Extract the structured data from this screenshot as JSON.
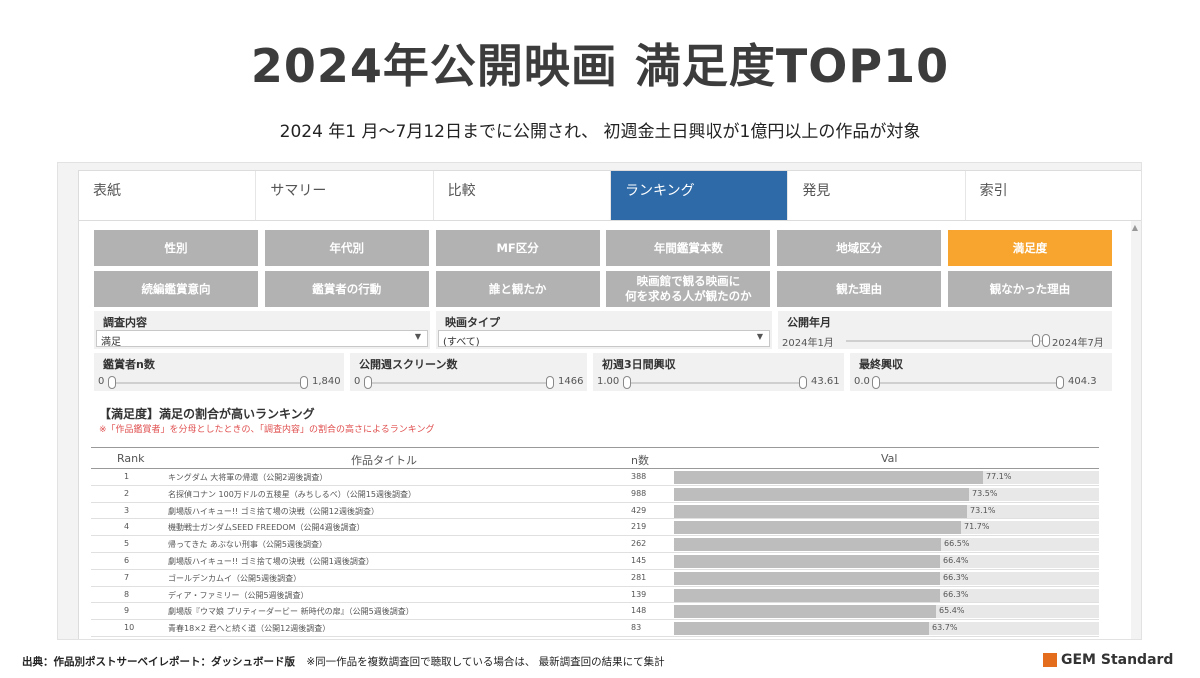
{
  "slide": {
    "title": "2024年公開映画 満足度TOP10",
    "subtitle": "2024 年1 月～7月12日までに公開され、 初週金土日興収が1億円以上の作品が対象"
  },
  "tabs": [
    {
      "label": "表紙",
      "active": false
    },
    {
      "label": "サマリー",
      "active": false
    },
    {
      "label": "比較",
      "active": false
    },
    {
      "label": "ランキング",
      "active": true
    },
    {
      "label": "発見",
      "active": false
    },
    {
      "label": "索引",
      "active": false
    }
  ],
  "category_buttons": [
    {
      "label": "性別",
      "active": false
    },
    {
      "label": "年代別",
      "active": false
    },
    {
      "label": "MF区分",
      "active": false
    },
    {
      "label": "年間鑑賞本数",
      "active": false
    },
    {
      "label": "地域区分",
      "active": false
    },
    {
      "label": "満足度",
      "active": true
    },
    {
      "label": "続編鑑賞意向",
      "active": false
    },
    {
      "label": "鑑賞者の行動",
      "active": false
    },
    {
      "label": "誰と観たか",
      "active": false
    },
    {
      "label": "映画館で観る映画に\n何を求める人が観たのか",
      "active": false
    },
    {
      "label": "観た理由",
      "active": false
    },
    {
      "label": "観なかった理由",
      "active": false
    }
  ],
  "filters": {
    "survey_content": {
      "label": "調査内容",
      "value": "満足"
    },
    "movie_type": {
      "label": "映画タイプ",
      "value": "(すべて)"
    },
    "release_period": {
      "label": "公開年月",
      "min": "2024年1月",
      "max": "2024年7月",
      "level_start": 0.95,
      "level_end": 1.0
    },
    "viewers_n": {
      "label": "鑑賞者n数",
      "min": "0",
      "max": "1,840",
      "level_start": 0.0,
      "level_end": 1.0
    },
    "screens": {
      "label": "公開週スクリーン数",
      "min": "0",
      "max": "1466",
      "level_start": 0.0,
      "level_end": 1.0
    },
    "first3days": {
      "label": "初週3日間興収",
      "min": "1.00",
      "max": "43.61",
      "level_start": 0.0,
      "level_end": 1.0
    },
    "final_box": {
      "label": "最終興収",
      "min": "0.0",
      "max": "404.3",
      "level_start": 0.0,
      "level_end": 1.0
    }
  },
  "ranking": {
    "title": "【満足度】満足の割合が高いランキング",
    "note": "※「作品鑑賞者」を分母としたときの、「調査内容」の割合の高さによるランキング",
    "headers": {
      "rank": "Rank",
      "title": "作品タイトル",
      "n": "n数",
      "val": "Val"
    },
    "rows": [
      {
        "rank": "1",
        "title": "キングダム 大将軍の帰還（公開2週後調査）",
        "n": "388",
        "val": 77.1,
        "val_label": "77.1%"
      },
      {
        "rank": "2",
        "title": "名探偵コナン 100万ドルの五稜星（みちしるべ）（公開15週後調査）",
        "n": "988",
        "val": 73.5,
        "val_label": "73.5%"
      },
      {
        "rank": "3",
        "title": "劇場版ハイキュー!! ゴミ捨て場の決戦（公開12週後調査）",
        "n": "429",
        "val": 73.1,
        "val_label": "73.1%"
      },
      {
        "rank": "4",
        "title": "機動戦士ガンダムSEED FREEDOM（公開4週後調査）",
        "n": "219",
        "val": 71.7,
        "val_label": "71.7%"
      },
      {
        "rank": "5",
        "title": "帰ってきた あぶない刑事（公開5週後調査）",
        "n": "262",
        "val": 66.5,
        "val_label": "66.5%"
      },
      {
        "rank": "6",
        "title": "劇場版ハイキュー!! ゴミ捨て場の決戦（公開1週後調査）",
        "n": "145",
        "val": 66.4,
        "val_label": "66.4%"
      },
      {
        "rank": "7",
        "title": "ゴールデンカムイ（公開5週後調査）",
        "n": "281",
        "val": 66.3,
        "val_label": "66.3%"
      },
      {
        "rank": "8",
        "title": "ディア・ファミリー（公開5週後調査）",
        "n": "139",
        "val": 66.3,
        "val_label": "66.3%"
      },
      {
        "rank": "9",
        "title": "劇場版『ウマ娘 プリティーダービー 新時代の扉』（公開5週後調査）",
        "n": "148",
        "val": 65.4,
        "val_label": "65.4%"
      },
      {
        "rank": "10",
        "title": "青春18×2 君へと続く道（公開12週後調査）",
        "n": "83",
        "val": 63.7,
        "val_label": "63.7%"
      }
    ]
  },
  "footer": {
    "source": "出典：作品別ポストサーベイレポート：ダッシュボード版",
    "note": "※同一作品を複数調査回で聴取している場合は、 最新調査回の結果にて集計"
  },
  "logo": {
    "text": "GEM Standard",
    "color": "#e36c1d"
  },
  "colors": {
    "active_tab": "#2e6aa8",
    "active_button": "#f7a52f",
    "button": "#b2b2b2",
    "bar": "#bdbdbd",
    "note": "#e05050"
  }
}
